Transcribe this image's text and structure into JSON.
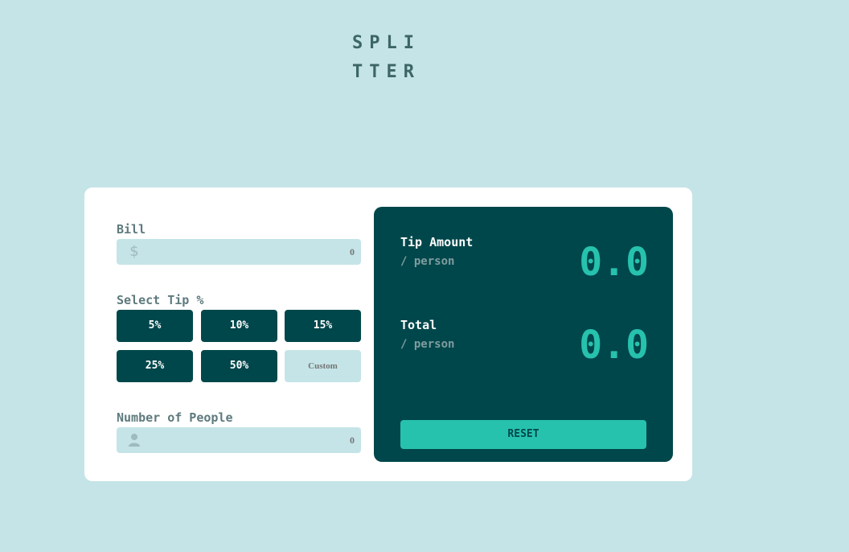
{
  "logo": {
    "line1": "SPLI",
    "line2": "TTER"
  },
  "bill": {
    "label": "Bill",
    "currency_symbol": "$",
    "placeholder": "0",
    "icon": "dollar-icon"
  },
  "tip": {
    "label": "Select Tip %",
    "options": [
      "5%",
      "10%",
      "15%",
      "25%",
      "50%"
    ],
    "custom_placeholder": "Custom"
  },
  "people": {
    "label": "Number of People",
    "placeholder": "0",
    "icon": "person-icon"
  },
  "results": {
    "tip_amount": {
      "title": "Tip Amount",
      "sub": "/ person",
      "value": "0.0"
    },
    "total": {
      "title": "Total",
      "sub": "/ person",
      "value": "0.0"
    },
    "reset_label": "RESET"
  },
  "colors": {
    "background": "#c5e4e7",
    "card": "#ffffff",
    "dark_cyan": "#00474b",
    "accent": "#26c2ad",
    "label": "#5e7a7d",
    "input_bg": "#c5e4e7"
  }
}
